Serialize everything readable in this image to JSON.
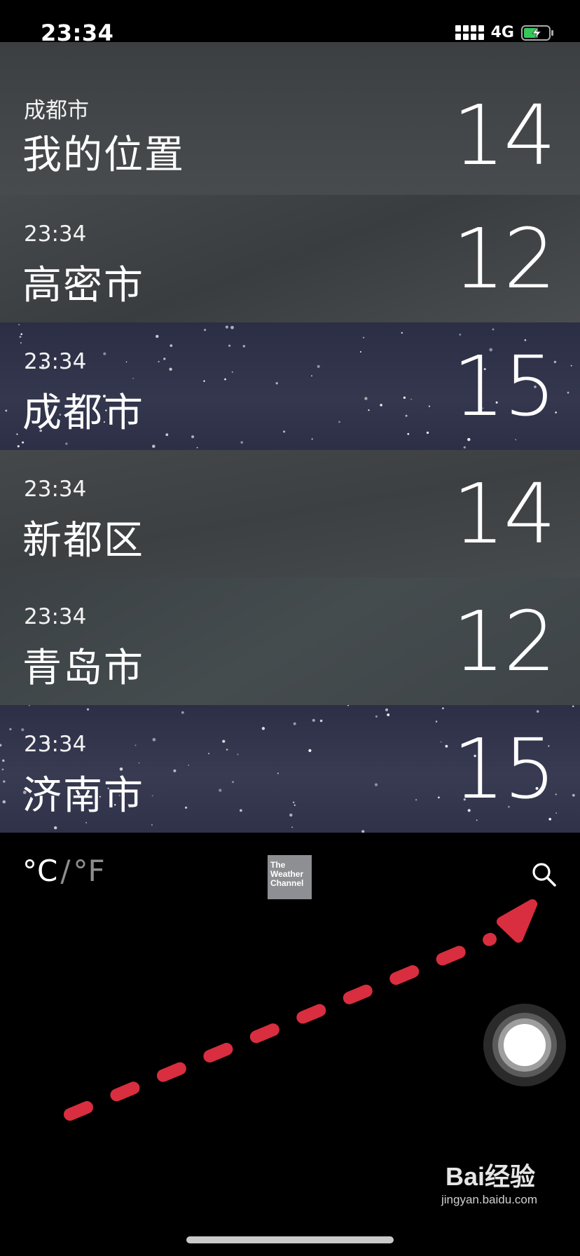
{
  "status_bar": {
    "time": "23:34",
    "network": "4G",
    "battery_charging": true
  },
  "locations": [
    {
      "subtitle": "成都市",
      "name": "我的位置",
      "temp": "14",
      "sky": "cloudy"
    },
    {
      "subtitle": "23:34",
      "name": "高密市",
      "temp": "12",
      "sky": "cloudy"
    },
    {
      "subtitle": "23:34",
      "name": "成都市",
      "temp": "15",
      "sky": "night"
    },
    {
      "subtitle": "23:34",
      "name": "新都区",
      "temp": "14",
      "sky": "cloudy"
    },
    {
      "subtitle": "23:34",
      "name": "青岛市",
      "temp": "12",
      "sky": "cloudy"
    },
    {
      "subtitle": "23:34",
      "name": "济南市",
      "temp": "15",
      "sky": "night"
    }
  ],
  "units": {
    "celsius": "°C",
    "separator": "/",
    "fahrenheit": "°F"
  },
  "weather_channel_logo": [
    "The",
    "Weather",
    "Channel"
  ],
  "watermark": {
    "logo": "Bai经验",
    "url": "jingyan.baidu.com"
  },
  "colors": {
    "arrow": "#d82e3f",
    "cloudy": "#3f4347",
    "night": "#2e3248"
  }
}
